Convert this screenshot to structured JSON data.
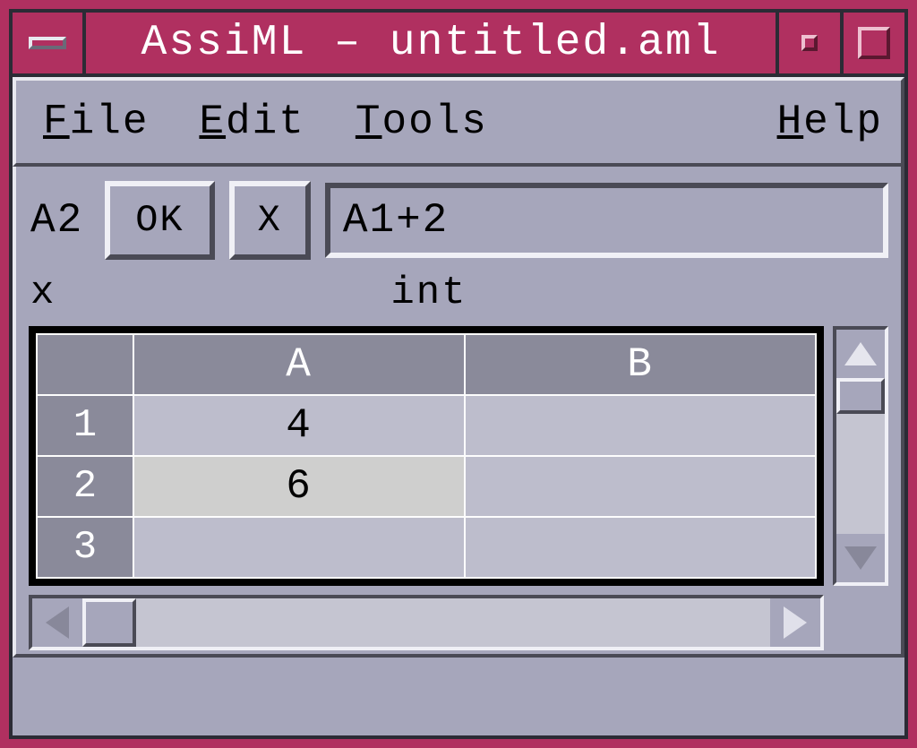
{
  "window": {
    "title": "AssiML – untitled.aml"
  },
  "menu": {
    "file": "File",
    "edit": "Edit",
    "tools": "Tools",
    "help": "Help"
  },
  "formula": {
    "cell_ref": "A2",
    "ok_label": "OK",
    "cancel_label": "X",
    "value": "A1+2"
  },
  "typeinfo": {
    "var": "x",
    "type": "int"
  },
  "sheet": {
    "columns": [
      "A",
      "B"
    ],
    "row_headers": [
      "1",
      "2",
      "3"
    ],
    "cells": {
      "A1": "4",
      "A2": "6",
      "A3": "",
      "B1": "",
      "B2": "",
      "B3": ""
    },
    "selected": "A2"
  }
}
